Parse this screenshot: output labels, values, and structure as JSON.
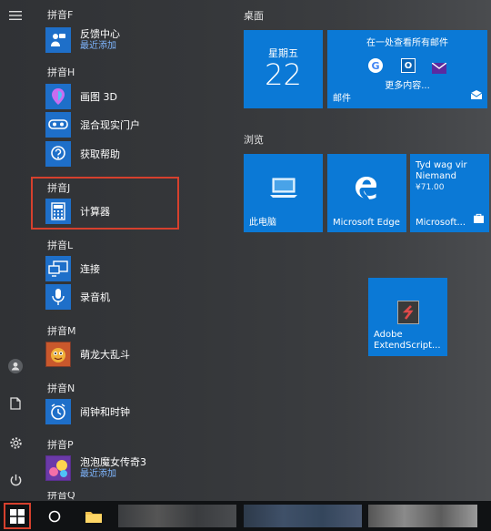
{
  "colors": {
    "accent": "#0b79d6",
    "highlight_border": "#d6402d",
    "subtext": "#7fb6ff"
  },
  "rail": {
    "icons": [
      "hamburger-menu-icon",
      "user-avatar-icon",
      "documents-icon",
      "settings-gear-icon",
      "power-icon"
    ]
  },
  "app_list": {
    "groups": [
      {
        "header": "拼音F",
        "apps": [
          {
            "name": "反馈中心",
            "sub": "最近添加",
            "icon": "feedback-hub-icon"
          }
        ]
      },
      {
        "header": "拼音H",
        "apps": [
          {
            "name": "画图 3D",
            "icon": "paint-3d-icon"
          },
          {
            "name": "混合现实门户",
            "icon": "mixed-reality-portal-icon"
          },
          {
            "name": "获取帮助",
            "icon": "get-help-icon"
          }
        ]
      },
      {
        "header": "拼音J",
        "apps": [
          {
            "name": "计算器",
            "icon": "calculator-icon"
          }
        ]
      },
      {
        "header": "拼音L",
        "apps": [
          {
            "name": "连接",
            "icon": "connect-icon"
          },
          {
            "name": "录音机",
            "icon": "voice-recorder-icon"
          }
        ]
      },
      {
        "header": "拼音M",
        "apps": [
          {
            "name": "萌龙大乱斗",
            "icon": "dragon-game-icon"
          }
        ]
      },
      {
        "header": "拼音N",
        "apps": [
          {
            "name": "闹钟和时钟",
            "icon": "alarm-clock-icon"
          }
        ]
      },
      {
        "header": "拼音P",
        "apps": [
          {
            "name": "泡泡魔女传奇3",
            "sub": "最近添加",
            "icon": "bubble-witch-game-icon"
          }
        ]
      },
      {
        "header": "拼音Q",
        "apps": []
      }
    ]
  },
  "tiles": {
    "section_desktop": "桌面",
    "section_browse": "浏览",
    "calendar": {
      "weekday": "星期五",
      "day": "22"
    },
    "mail": {
      "title": "在一处查看所有邮件",
      "more": "更多内容...",
      "label": "邮件"
    },
    "pc": {
      "label": "此电脑"
    },
    "edge": {
      "label": "Microsoft Edge"
    },
    "store": {
      "title_line1": "Tyd wag vir",
      "title_line2": "Niemand",
      "price": "¥71.00",
      "label": "Microsoft..."
    },
    "adobe": {
      "line1": "Adobe",
      "line2": "ExtendScript..."
    }
  },
  "taskbar": {
    "icons": [
      "windows-start-icon",
      "cortana-search-icon",
      "file-explorer-icon"
    ]
  }
}
